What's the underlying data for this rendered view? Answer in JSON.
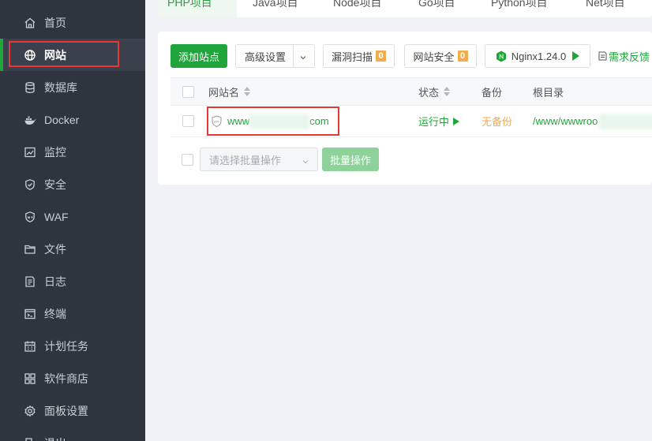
{
  "sidebar": {
    "items": [
      {
        "label": "首页",
        "icon": "home-icon",
        "active": false
      },
      {
        "label": "网站",
        "icon": "globe-icon",
        "active": true
      },
      {
        "label": "数据库",
        "icon": "database-icon",
        "active": false
      },
      {
        "label": "Docker",
        "icon": "docker-icon",
        "active": false
      },
      {
        "label": "监控",
        "icon": "monitor-chart-icon",
        "active": false
      },
      {
        "label": "安全",
        "icon": "shield-icon",
        "active": false
      },
      {
        "label": "WAF",
        "icon": "waf-shield-icon",
        "active": false
      },
      {
        "label": "文件",
        "icon": "folder-icon",
        "active": false
      },
      {
        "label": "日志",
        "icon": "log-icon",
        "active": false
      },
      {
        "label": "终端",
        "icon": "terminal-icon",
        "active": false
      },
      {
        "label": "计划任务",
        "icon": "calendar-icon",
        "active": false
      },
      {
        "label": "软件商店",
        "icon": "apps-icon",
        "active": false
      },
      {
        "label": "面板设置",
        "icon": "gear-icon",
        "active": false
      },
      {
        "label": "退出",
        "icon": "logout-icon",
        "active": false
      }
    ]
  },
  "tabs": [
    {
      "label": "PHP项目",
      "active": true
    },
    {
      "label": "Java项目",
      "active": false
    },
    {
      "label": "Node项目",
      "active": false
    },
    {
      "label": "Go项目",
      "active": false
    },
    {
      "label": "Python项目",
      "active": false
    },
    {
      "label": "Net项目",
      "active": false
    }
  ],
  "toolbar": {
    "add_site": "添加站点",
    "advanced": "高级设置",
    "vuln_scan": "漏洞扫描",
    "vuln_scan_count": "0",
    "site_security": "网站安全",
    "site_security_count": "0",
    "nginx": "Nginx1.24.0",
    "feedback": "需求反馈"
  },
  "table": {
    "headers": {
      "name": "网站名",
      "status": "状态",
      "backup": "备份",
      "root": "根目录"
    },
    "rows": [
      {
        "name_prefix": "www",
        "name_suffix": "com",
        "status": "运行中",
        "backup": "无备份",
        "root": "/www/wwwroo"
      }
    ]
  },
  "batch": {
    "placeholder": "请选择批量操作",
    "button": "批量操作"
  },
  "colors": {
    "accent": "#20a53a",
    "sidebar_bg": "#2f353f",
    "warning": "#f0ad4e",
    "highlight": "#e53935"
  }
}
